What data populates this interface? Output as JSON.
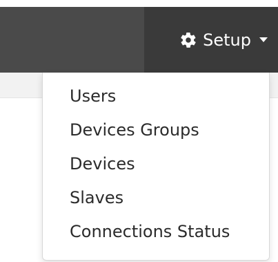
{
  "navbar": {
    "setup": {
      "label": "Setup",
      "icon": "gear-icon"
    }
  },
  "dropdown": {
    "items": [
      {
        "label": "Users"
      },
      {
        "label": "Devices Groups"
      },
      {
        "label": "Devices"
      },
      {
        "label": "Slaves"
      },
      {
        "label": "Connections Status"
      }
    ]
  },
  "colors": {
    "navbar_bg": "#3c3c3c",
    "text": "#2b2b2b"
  }
}
